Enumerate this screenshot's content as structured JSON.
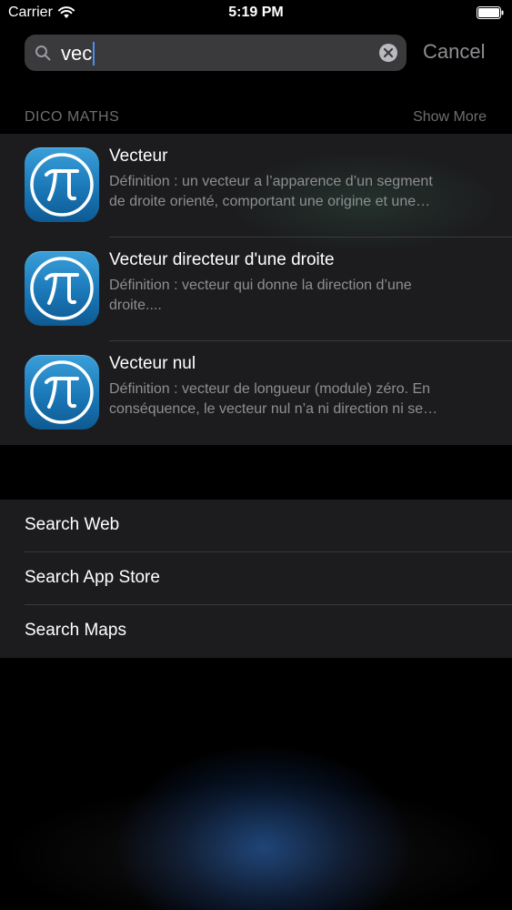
{
  "status_bar": {
    "carrier": "Carrier",
    "time": "5:19 PM"
  },
  "search": {
    "query": "vec",
    "cancel_label": "Cancel"
  },
  "section": {
    "title": "DICO MATHS",
    "show_more": "Show More"
  },
  "results": [
    {
      "title": "Vecteur",
      "line1": "Définition : un vecteur a l’apparence d’un segment",
      "line2": "de droite orienté, comportant une origine et une…",
      "icon": "pi-app-icon"
    },
    {
      "title": "Vecteur directeur d'une droite",
      "line1": "Définition : vecteur qui donne la direction d’une",
      "line2": "droite....",
      "icon": "pi-app-icon"
    },
    {
      "title": "Vecteur nul",
      "line1": "Définition : vecteur de longueur (module) zéro. En",
      "line2": "conséquence, le vecteur nul n’a ni direction ni se…",
      "icon": "pi-app-icon"
    }
  ],
  "search_options": [
    "Search Web",
    "Search App Store",
    "Search Maps"
  ],
  "colors": {
    "accent": "#4a90f0",
    "panel": "#1c1c1e",
    "secondary_text": "#8e8e93",
    "app_icon": "#1a78b8"
  }
}
